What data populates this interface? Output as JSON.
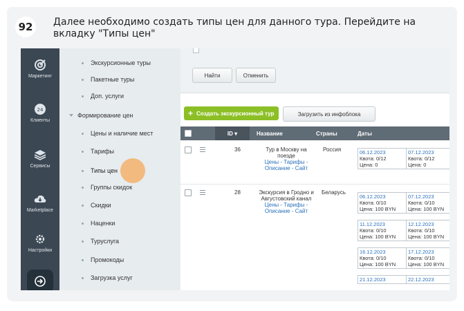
{
  "step": {
    "number": "92",
    "text": "Далее необходимо создать типы цен для данного тура. Перейдите на вкладку \"Типы цен\""
  },
  "leftbar": {
    "items": [
      {
        "label": "Маркетинг",
        "icon": "target-icon"
      },
      {
        "label": "Клиенты",
        "icon": "clients-icon"
      },
      {
        "label": "Сервисы",
        "icon": "layers-icon"
      },
      {
        "label": "Marketplace",
        "icon": "cloud-download-icon"
      },
      {
        "label": "Настройки",
        "icon": "gear-icon"
      }
    ]
  },
  "menu": {
    "items": [
      {
        "label": "Экскурсионные туры"
      },
      {
        "label": "Пакетные туры"
      },
      {
        "label": "Доп. услуги"
      },
      {
        "label": "Формирование цен"
      },
      {
        "label": "Цены и наличие мест"
      },
      {
        "label": "Тарифы"
      },
      {
        "label": "Типы цен"
      },
      {
        "label": "Группы скидок"
      },
      {
        "label": "Скидки"
      },
      {
        "label": "Наценки"
      },
      {
        "label": "Туруслуга"
      },
      {
        "label": "Промокоды"
      },
      {
        "label": "Загрузка услуг"
      }
    ]
  },
  "filter": {
    "find": "Найти",
    "cancel": "Отменить"
  },
  "toolbar": {
    "create": "Создать экскурсионный тур",
    "load": "Загрузить из инфоблока"
  },
  "table": {
    "headers": {
      "id": "ID",
      "name": "Название",
      "country": "Страны",
      "dates": "Даты"
    },
    "rows": [
      {
        "id": "36",
        "name": "Тур в Москву на поезде",
        "links": "Цены - Тарифы - Описание - Сайт",
        "country": "Россия",
        "dates": [
          {
            "date": "06.12.2023",
            "quota": "Квота: 0/12",
            "price": "Цена: 0"
          },
          {
            "date": "07.12.2023",
            "quota": "Квота: 0/12",
            "price": "Цена: 0"
          }
        ]
      },
      {
        "id": "28",
        "name": "Экскурсия в Гродно и Августовский канал",
        "links": "Цены - Тарифы - Описание - Сайт",
        "country": "Беларусь",
        "dates": [
          {
            "date": "06.12.2023",
            "quota": "Квота: 0/10",
            "price": "Цена: 100 BYN"
          },
          {
            "date": "07.12.2023",
            "quota": "Квота: 0/10",
            "price": "Цена: 100 BYN"
          },
          {
            "date": "11.12.2023",
            "quota": "Квота: 0/10",
            "price": "Цена: 100 BYN"
          },
          {
            "date": "12.12.2023",
            "quota": "Квота: 0/10",
            "price": "Цена: 100 BYN"
          },
          {
            "date": "16.12.2023",
            "quota": "Квота: 0/10",
            "price": "Цена: 100 BYN"
          },
          {
            "date": "17.12.2023",
            "quota": "Квота: 0/10",
            "price": "Цена: 100 BYN"
          },
          {
            "date": "21.12.2023",
            "quota": "",
            "price": ""
          },
          {
            "date": "22.12.2023",
            "quota": "",
            "price": ""
          }
        ]
      }
    ]
  }
}
